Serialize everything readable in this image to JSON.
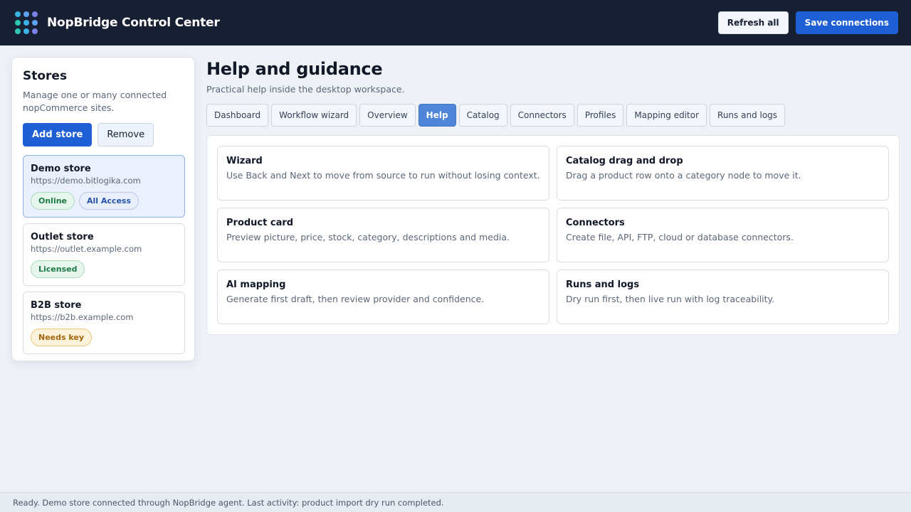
{
  "app": {
    "title": "NopBridge Control Center",
    "logo_icon": "dot-grid-logo-icon",
    "logo_colors": [
      "#3bb3e5",
      "#5ea0f0",
      "#7b7fe8",
      "#2cc7b5"
    ]
  },
  "header": {
    "refresh_label": "Refresh all",
    "save_label": "Save connections"
  },
  "sidebar": {
    "title": "Stores",
    "description": "Manage one or many connected nopCommerce sites.",
    "add_label": "Add store",
    "remove_label": "Remove",
    "stores": [
      {
        "name": "Demo store",
        "url": "https://demo.bitlogika.com",
        "badges": [
          "Online",
          "All Access"
        ],
        "selected": true
      },
      {
        "name": "Outlet store",
        "url": "https://outlet.example.com",
        "badges": [
          "Licensed"
        ]
      },
      {
        "name": "B2B store",
        "url": "https://b2b.example.com",
        "badges": [
          "Needs key"
        ]
      }
    ]
  },
  "main": {
    "title": "Help and guidance",
    "subtitle": "Practical help inside the desktop workspace.",
    "tabs": [
      {
        "label": "Dashboard"
      },
      {
        "label": "Workflow wizard"
      },
      {
        "label": "Overview"
      },
      {
        "label": "Help",
        "active": true
      },
      {
        "label": "Catalog"
      },
      {
        "label": "Connectors"
      },
      {
        "label": "Profiles"
      },
      {
        "label": "Mapping editor"
      },
      {
        "label": "Runs and logs"
      }
    ],
    "help_cards": [
      {
        "title": "Wizard",
        "body": "Use Back and Next to move from source to run without losing context."
      },
      {
        "title": "Catalog drag and drop",
        "body": "Drag a product row onto a category node to move it."
      },
      {
        "title": "Product card",
        "body": "Preview picture, price, stock, category, descriptions and media."
      },
      {
        "title": "Connectors",
        "body": "Create file, API, FTP, cloud or database connectors."
      },
      {
        "title": "AI mapping",
        "body": "Generate first draft, then review provider and confidence."
      },
      {
        "title": "Runs and logs",
        "body": "Dry run first, then live run with log traceability."
      }
    ]
  },
  "status": {
    "text": "Ready. Demo store connected through NopBridge agent. Last activity: product import dry run completed."
  },
  "colors": {
    "header_bg": "#172033",
    "accent": "#1f5fd6",
    "active_tab": "#4f86d9",
    "online": "#1c7a45",
    "needs_key": "#a2650d"
  }
}
